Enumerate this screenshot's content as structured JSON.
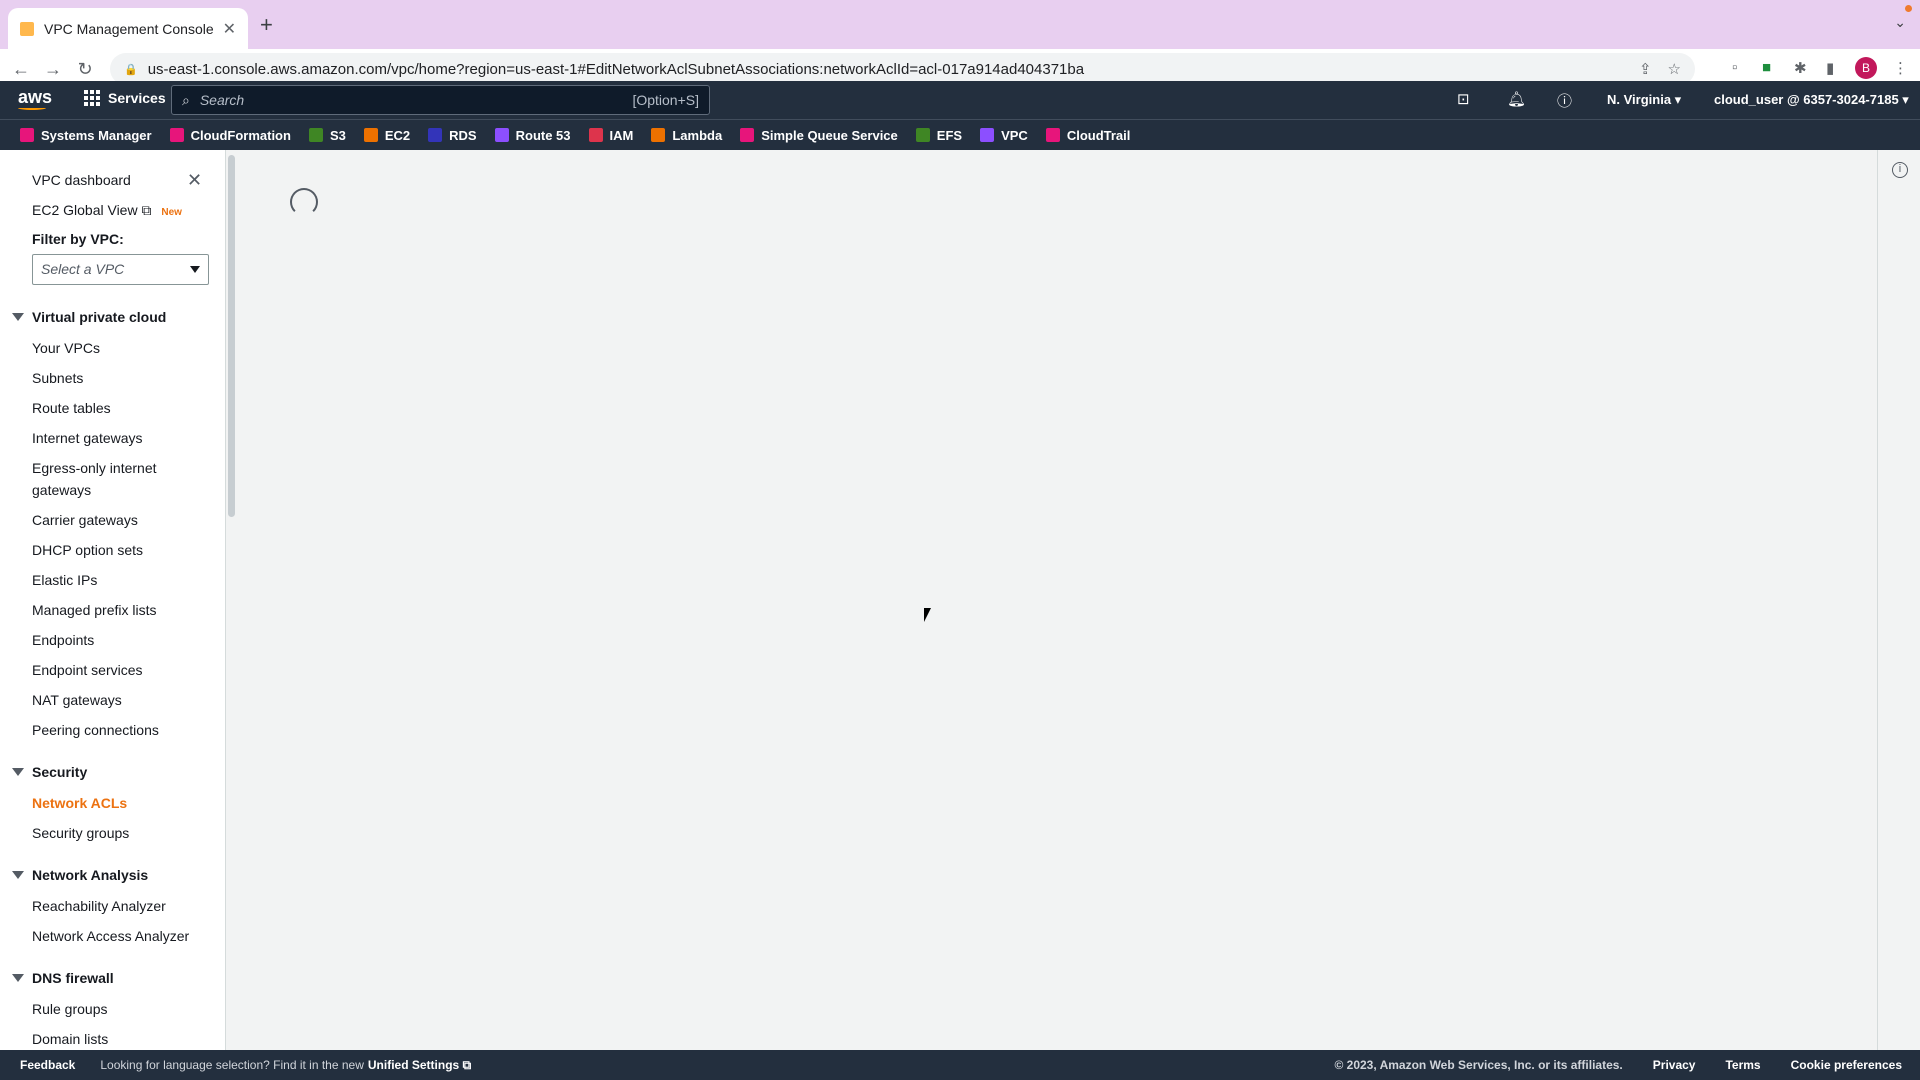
{
  "browser": {
    "tab_title": "VPC Management Console",
    "url": "us-east-1.console.aws.amazon.com/vpc/home?region=us-east-1#EditNetworkAclSubnetAssociations:networkAclId=acl-017a914ad404371ba",
    "profile_initial": "B"
  },
  "header": {
    "logo": "aws",
    "services_label": "Services",
    "search_placeholder": "Search",
    "search_shortcut": "[Option+S]",
    "region": "N. Virginia",
    "account": "cloud_user @ 6357-3024-7185"
  },
  "favorites": [
    {
      "label": "Systems Manager",
      "color": "#e7157b"
    },
    {
      "label": "CloudFormation",
      "color": "#e7157b"
    },
    {
      "label": "S3",
      "color": "#3f8624"
    },
    {
      "label": "EC2",
      "color": "#ed7100"
    },
    {
      "label": "RDS",
      "color": "#3334b9"
    },
    {
      "label": "Route 53",
      "color": "#8c4fff"
    },
    {
      "label": "IAM",
      "color": "#dd344c"
    },
    {
      "label": "Lambda",
      "color": "#ed7100"
    },
    {
      "label": "Simple Queue Service",
      "color": "#e7157b"
    },
    {
      "label": "EFS",
      "color": "#3f8624"
    },
    {
      "label": "VPC",
      "color": "#8c4fff"
    },
    {
      "label": "CloudTrail",
      "color": "#e7157b"
    }
  ],
  "sidebar": {
    "dashboard": "VPC dashboard",
    "global_view": "EC2 Global View",
    "new_badge": "New",
    "filter_label": "Filter by VPC:",
    "filter_placeholder": "Select a VPC",
    "sections": {
      "vpc": "Virtual private cloud",
      "security": "Security",
      "analysis": "Network Analysis",
      "dns": "DNS firewall"
    },
    "vpc_items": [
      "Your VPCs",
      "Subnets",
      "Route tables",
      "Internet gateways",
      "Egress-only internet",
      "gateways",
      "Carrier gateways",
      "DHCP option sets",
      "Elastic IPs",
      "Managed prefix lists",
      "Endpoints",
      "Endpoint services",
      "NAT gateways",
      "Peering connections"
    ],
    "security_items": [
      "Network ACLs",
      "Security groups"
    ],
    "analysis_items": [
      "Reachability Analyzer",
      "Network Access Analyzer"
    ],
    "dns_items": [
      "Rule groups",
      "Domain lists"
    ]
  },
  "footer": {
    "feedback": "Feedback",
    "message": "Looking for language selection? Find it in the new",
    "unified": "Unified Settings",
    "copyright": "© 2023, Amazon Web Services, Inc. or its affiliates.",
    "privacy": "Privacy",
    "terms": "Terms",
    "cookies": "Cookie preferences"
  }
}
